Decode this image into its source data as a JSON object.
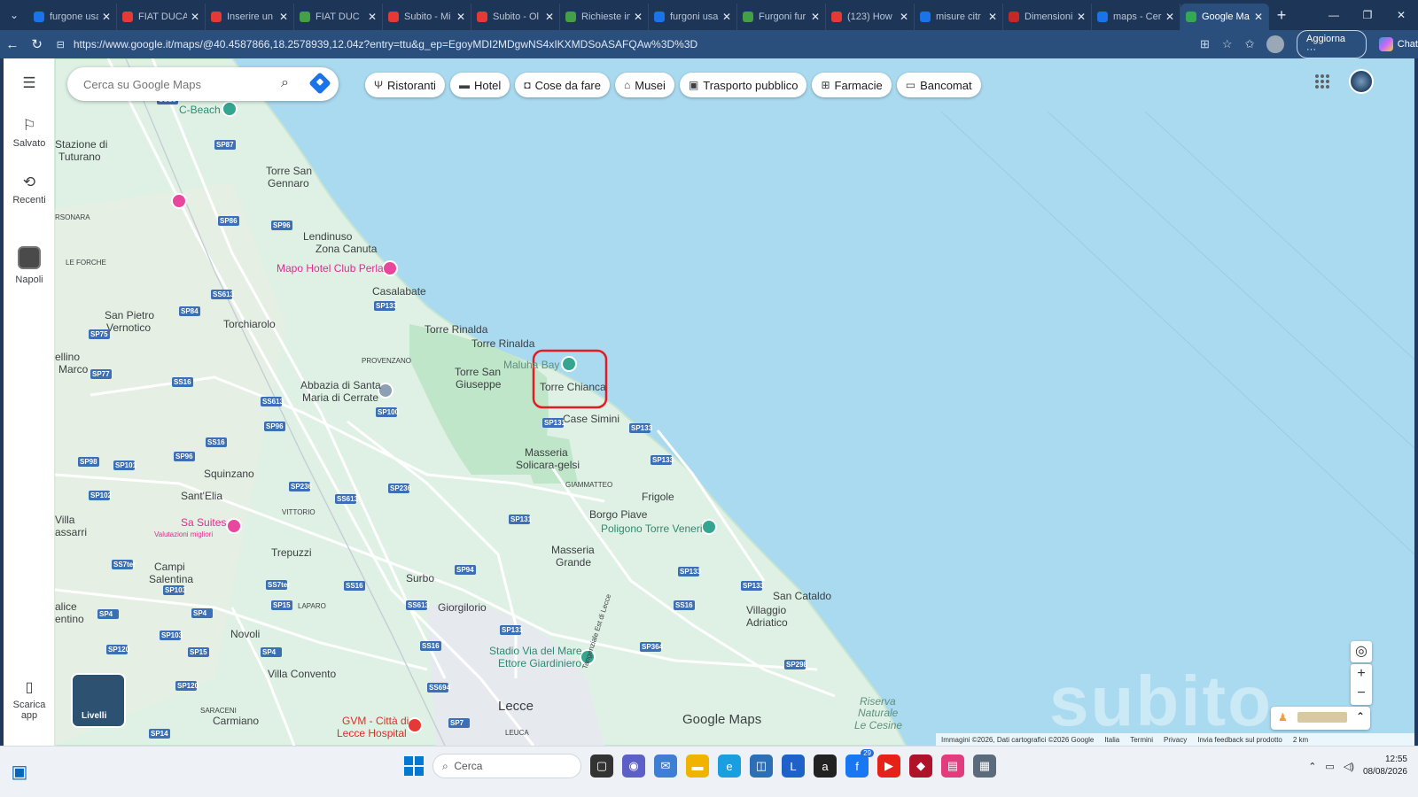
{
  "browser": {
    "tabs": [
      {
        "label": "furgone usa",
        "fav_color": "#1a73e8",
        "active": false
      },
      {
        "label": "FIAT DUCAT",
        "fav_color": "#e53935",
        "active": false
      },
      {
        "label": "Inserire un",
        "fav_color": "#e53935",
        "active": false
      },
      {
        "label": "FIAT DUC",
        "fav_color": "#43a047",
        "active": false
      },
      {
        "label": "Subito - Mi",
        "fav_color": "#e53935",
        "active": false
      },
      {
        "label": "Subito - Ol",
        "fav_color": "#e53935",
        "active": false
      },
      {
        "label": "Richieste in",
        "fav_color": "#43a047",
        "active": false
      },
      {
        "label": "furgoni usa",
        "fav_color": "#1a73e8",
        "active": false
      },
      {
        "label": "Furgoni fur",
        "fav_color": "#43a047",
        "active": false
      },
      {
        "label": "(123) How",
        "fav_color": "#e53935",
        "active": false
      },
      {
        "label": "misure citr",
        "fav_color": "#1a73e8",
        "active": false
      },
      {
        "label": "Dimensioni",
        "fav_color": "#c62828",
        "active": false
      },
      {
        "label": "maps - Cer",
        "fav_color": "#1a73e8",
        "active": false
      },
      {
        "label": "Google Ma",
        "fav_color": "#34a853",
        "active": true
      }
    ],
    "url": "https://www.google.it/maps/@40.4587866,18.2578939,12.04z?entry=ttu&g_ep=EgoyMDI2MDgwNS4xIKXMDSoASAFQAw%3D%3D",
    "update_label": "Aggiorna",
    "chat_label": "Chat"
  },
  "rail": {
    "saved_label": "Salvato",
    "recent_label": "Recenti",
    "recent_place_label": "Napoli",
    "download_label": "Scarica app"
  },
  "search": {
    "placeholder": "Cerca su Google Maps"
  },
  "chips": [
    {
      "label": "Ristoranti",
      "icon": "restaurant-icon"
    },
    {
      "label": "Hotel",
      "icon": "hotel-icon"
    },
    {
      "label": "Cose da fare",
      "icon": "camera-icon"
    },
    {
      "label": "Musei",
      "icon": "museum-icon"
    },
    {
      "label": "Trasporto pubblico",
      "icon": "transit-icon"
    },
    {
      "label": "Farmacie",
      "icon": "pharmacy-icon"
    },
    {
      "label": "Bancomat",
      "icon": "atm-icon"
    }
  ],
  "map": {
    "places": {
      "c_beach": "C-Beach",
      "stazione": "Stazione di",
      "tuturano": "Tuturano",
      "torre_san_gennaro_1": "Torre San",
      "torre_san_gennaro_2": "Gennaro",
      "rsonara": "RSONARA",
      "le_forche": "LE FORCHE",
      "lendinuso": "Lendinuso",
      "zona_canuta": "Zona Canuta",
      "mapo_hotel": "Mapo Hotel Club Perla",
      "casalabate": "Casalabate",
      "san_pietro_1": "San Pietro",
      "san_pietro_2": "Vernotico",
      "torchiarolo": "Torchiarolo",
      "torre_rinalda_1": "Torre Rinalda",
      "torre_rinalda_2": "Torre Rinalda",
      "ellino": "ellino",
      "marco": "Marco",
      "provenzano": "PROVENZANO",
      "torre_san_giuseppe_1": "Torre San",
      "torre_san_giuseppe_2": "Giuseppe",
      "maluha_bay": "Maluha Bay",
      "torre_chianca": "Torre Chianca",
      "abbazia_1": "Abbazia di Santa",
      "abbazia_2": "Maria di Cerrate",
      "case_simini": "Case Simini",
      "masseria_solicara_1": "Masseria",
      "masseria_solicara_2": "Solicara-gelsi",
      "squinzano": "Squinzano",
      "giammatteo": "GIAMMATTEO",
      "frigole": "Frigole",
      "sant_elia": "Sant'Elia",
      "vittorio": "VITTORIO",
      "borgo_piave": "Borgo Piave",
      "poligono": "Poligono Torre Veneri",
      "villa": "Villa",
      "assarri": "assarri",
      "sa_suites": "Sa Suites",
      "sa_suites_sub": "Valutazioni migliori",
      "masseria_grande_1": "Masseria",
      "masseria_grande_2": "Grande",
      "campi_1": "Campi",
      "campi_2": "Salentina",
      "trepuzzi": "Trepuzzi",
      "surbo": "Surbo",
      "san_cataldo": "San Cataldo",
      "alice": "alice",
      "entino": "entino",
      "laparo": "LAPARO",
      "giorgilorio": "Giorgilorio",
      "villaggio_1": "Villaggio",
      "villaggio_2": "Adriatico",
      "novoli": "Novoli",
      "stadio_1": "Stadio Via del Mare",
      "stadio_2": "Ettore Giardiniero",
      "villa_convento": "Villa Convento",
      "lecce": "Lecce",
      "saraceni": "SARACENI",
      "carmiano": "Carmiano",
      "gvm_1": "GVM - Città di",
      "gvm_2": "Lecce Hospital",
      "leuca": "LEUCA",
      "riserva_1": "Riserva",
      "riserva_2": "Naturale",
      "riserva_3": "Le Cesine",
      "tangenziale": "Tangenziale Est di Lecce"
    },
    "roads": [
      "SS16",
      "SP87",
      "SP86",
      "SP96",
      "SP133",
      "SS613",
      "SP84",
      "SP75",
      "SP77",
      "SS16",
      "SS613",
      "SP96",
      "SP100",
      "SS16",
      "SP98",
      "SP101",
      "SP96",
      "SP131",
      "SP133",
      "SP133",
      "SP102",
      "SP236",
      "SP236",
      "SS613",
      "SP131",
      "SP94",
      "SP133",
      "SS7ter",
      "SP103",
      "SS7ter",
      "SS16",
      "SS613",
      "SP4",
      "SP4",
      "SP15",
      "SP131",
      "SP133",
      "SP103",
      "SP120",
      "SP15",
      "SP4",
      "SS16",
      "SP364",
      "SP298",
      "SP120",
      "SS694",
      "SP7",
      "SP14",
      "SS16"
    ],
    "google_maps_logo": "Google Maps",
    "layers_label": "Livelli",
    "attribution": [
      "Immagini ©2026, Dati cartografici ©2026 Google",
      "Italia",
      "Termini",
      "Privacy",
      "Invia feedback sul prodotto",
      "2 km"
    ],
    "watermark": "subito"
  },
  "taskbar": {
    "search_placeholder": "Cerca",
    "time": "12:55",
    "date": "08/08/2026",
    "badge": "29"
  }
}
